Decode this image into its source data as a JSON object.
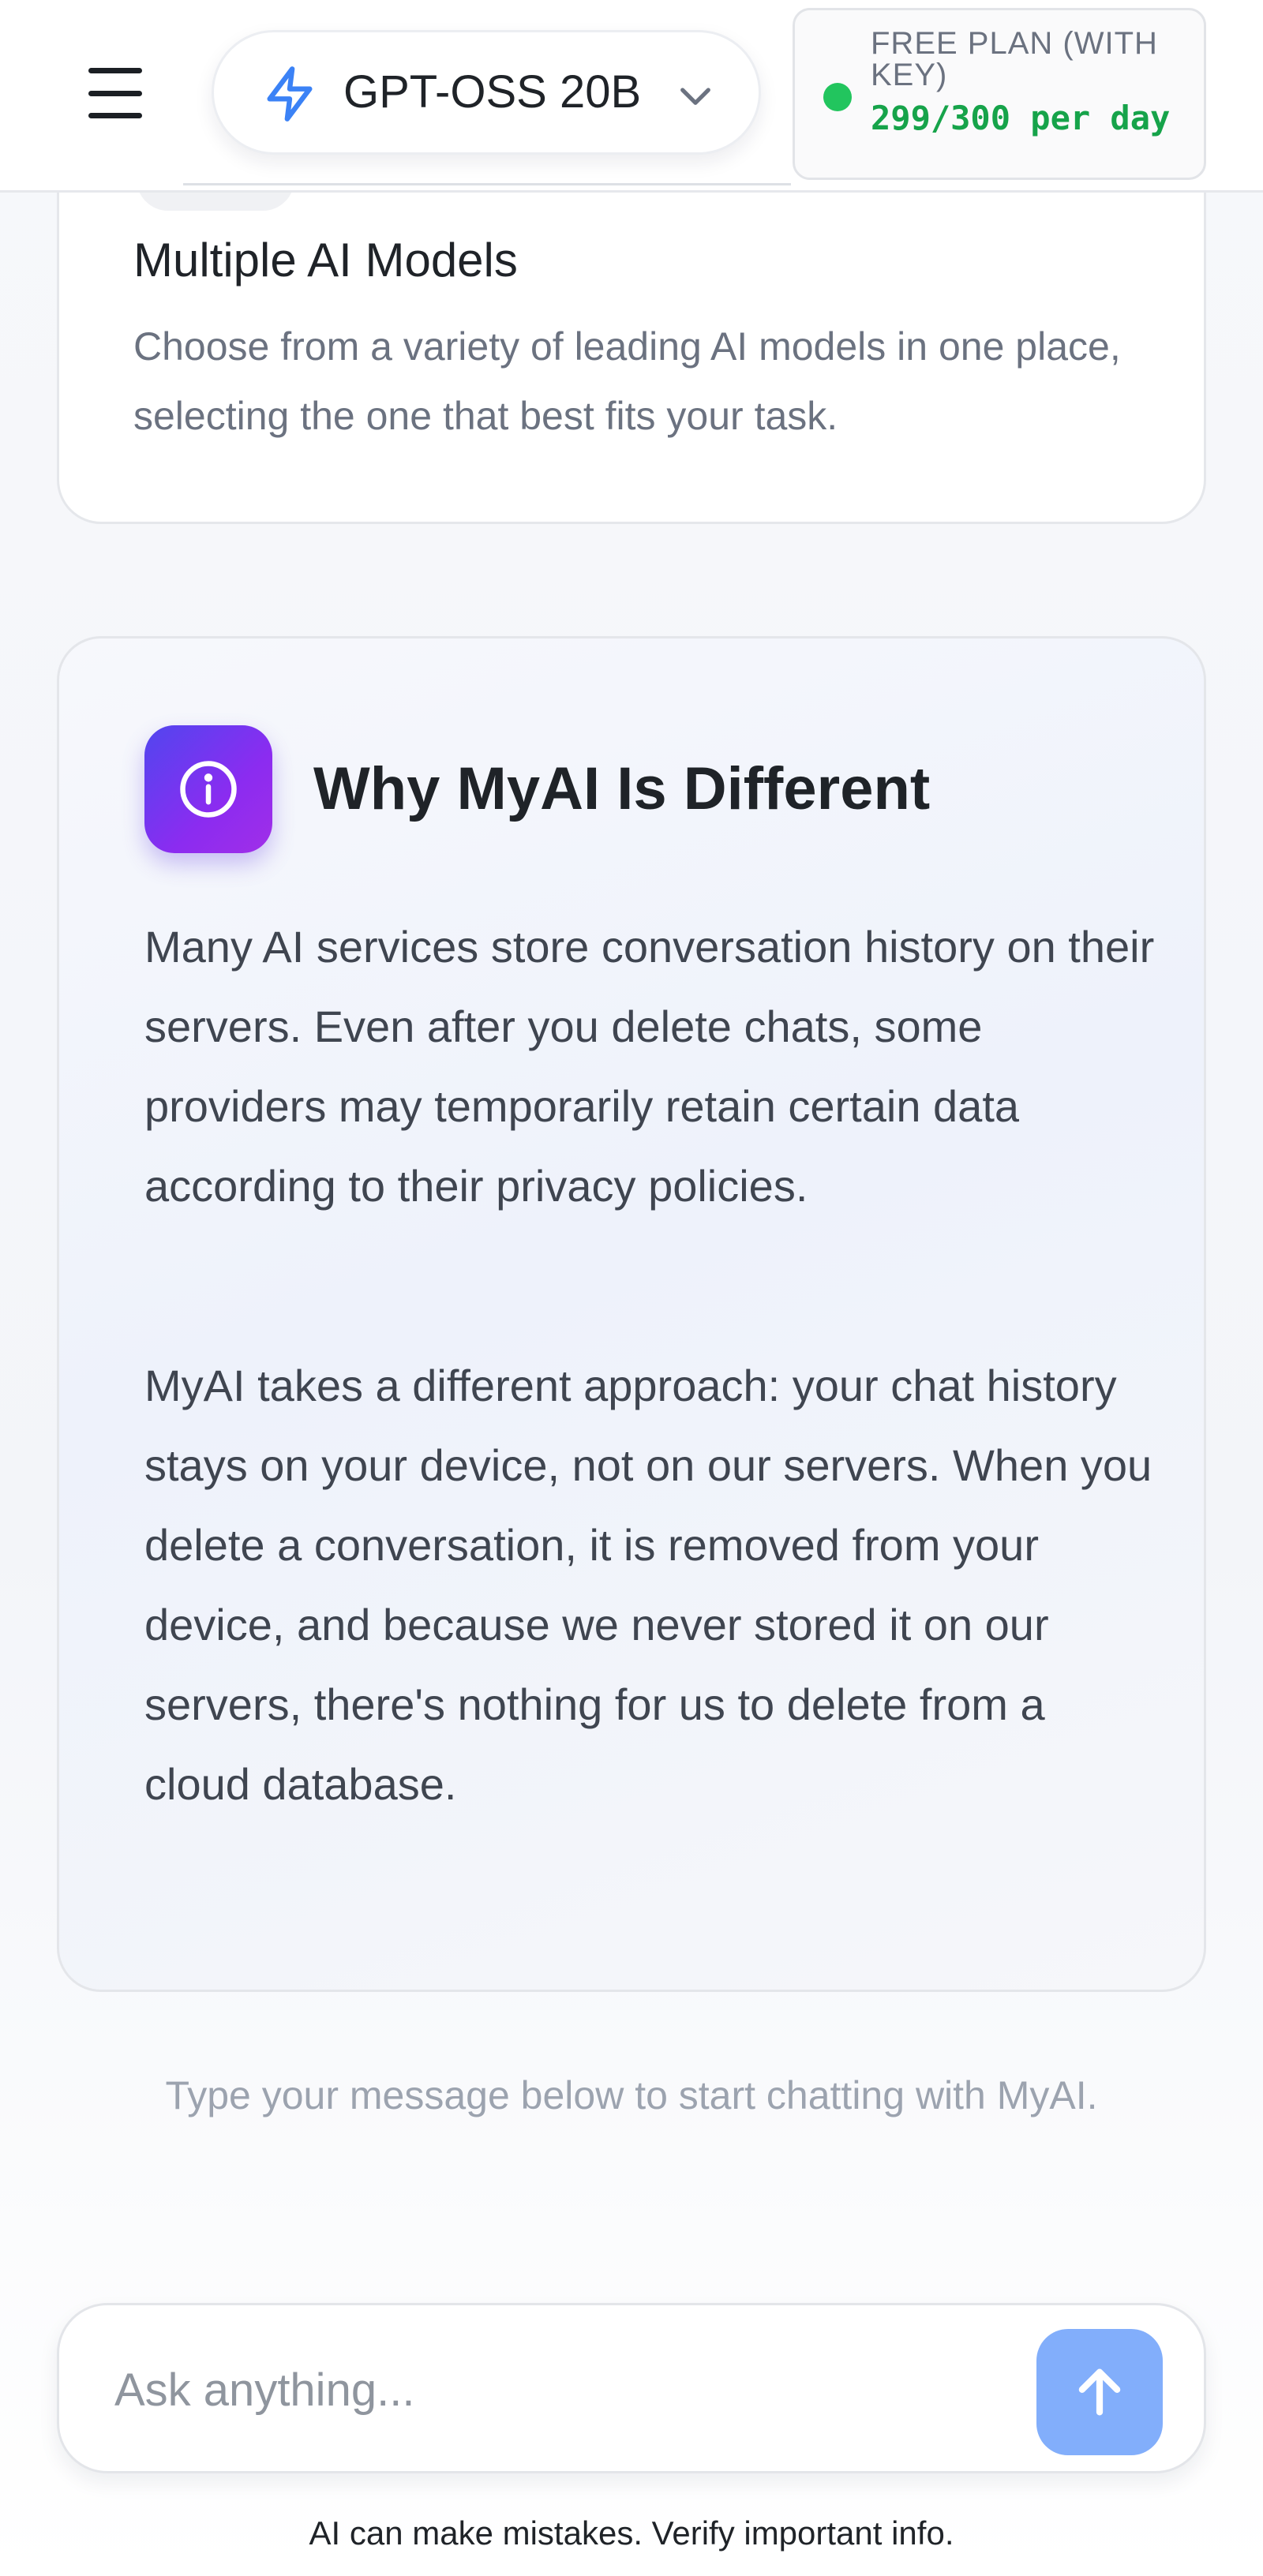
{
  "header": {
    "menu_icon": "hamburger-menu-icon",
    "model_selector": {
      "icon": "lightning-bolt-icon",
      "label": "GPT-OSS 20B",
      "chevron": "chevron-down-icon"
    },
    "plan": {
      "title": "FREE PLAN (WITH KEY)",
      "usage": "299/300 per day",
      "status_color": "#22c55e"
    }
  },
  "feature_card": {
    "title": "Multiple AI Models",
    "description": "Choose from a variety of leading AI models in one place, selecting the one that best fits your task."
  },
  "why_card": {
    "icon": "info-icon",
    "title": "Why MyAI Is Different",
    "paragraphs": [
      "Many AI services store conversation history on their servers. Even after you delete chats, some providers may temporarily retain certain data according to their privacy policies.",
      "MyAI takes a different approach: your chat history stays on your device, not on our servers. When you delete a conversation, it is removed from your device, and because we never stored it on our servers, there's nothing for us to delete from a cloud database."
    ],
    "accent_gradient": [
      "#5146ef",
      "#a12ee8"
    ]
  },
  "hint": "Type your message below to start chatting with MyAI.",
  "composer": {
    "placeholder": "Ask anything...",
    "send_icon": "arrow-up-icon",
    "send_color": "#82aefb"
  },
  "disclaimer": "AI can make mistakes. Verify important info."
}
